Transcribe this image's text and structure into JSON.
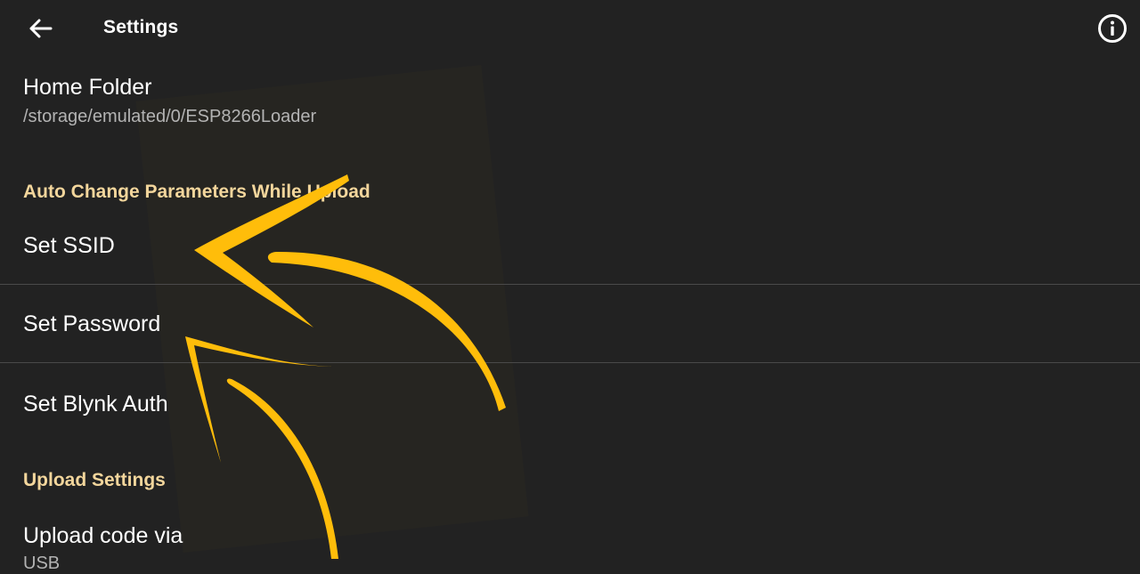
{
  "header": {
    "title": "Settings",
    "back_icon": "arrow-left-icon",
    "info_icon": "info-circle-icon"
  },
  "preferences": {
    "home_folder": {
      "title": "Home Folder",
      "summary": "/storage/emulated/0/ESP8266Loader"
    },
    "auto_change_category": "Auto Change Parameters While Upload",
    "set_ssid": {
      "title": "Set SSID"
    },
    "set_password": {
      "title": "Set Password"
    },
    "set_blynk_auth": {
      "title": "Set Blynk Auth"
    },
    "upload_settings_category": "Upload Settings",
    "upload_code_via": {
      "title": "Upload code via",
      "summary": "USB"
    }
  },
  "annotation": {
    "arrow_color": "#FFBD0A",
    "arrow_count": 3
  }
}
